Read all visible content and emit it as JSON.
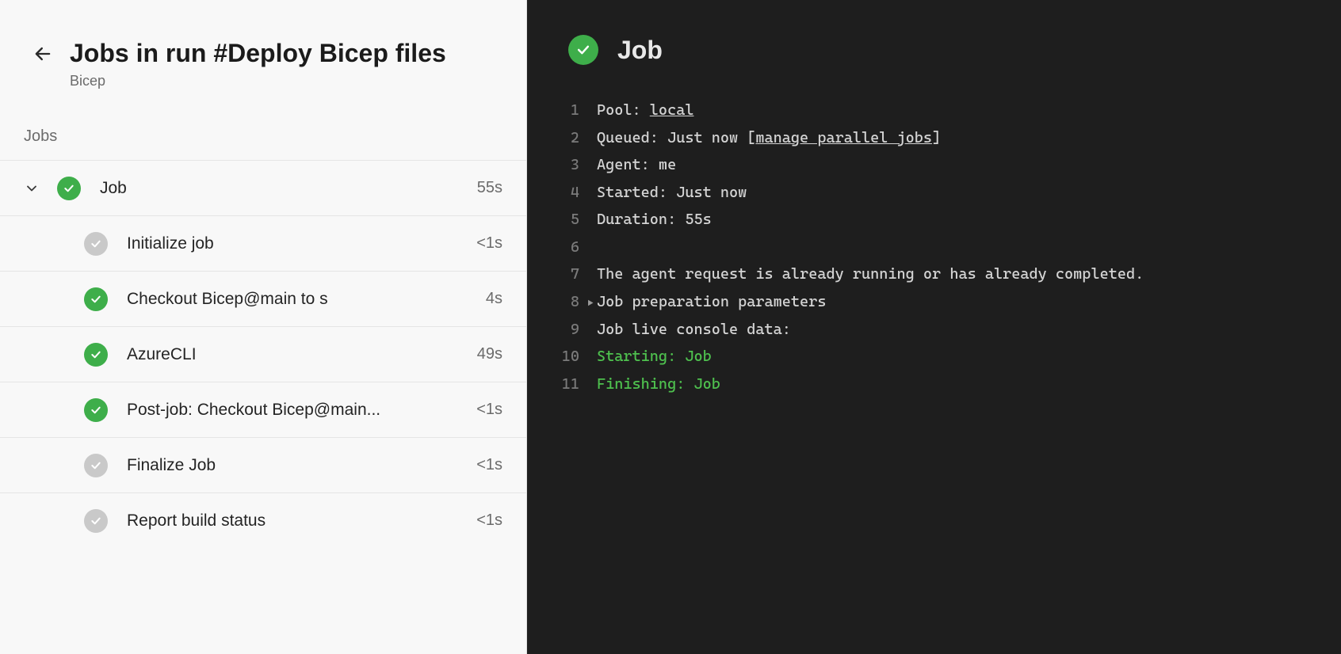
{
  "header": {
    "title": "Jobs in run #Deploy Bicep files",
    "subtitle": "Bicep"
  },
  "jobs_section_label": "Jobs",
  "job": {
    "name": "Job",
    "duration": "55s",
    "status": "success"
  },
  "steps": [
    {
      "label": "Initialize job",
      "duration": "<1s",
      "status": "grey"
    },
    {
      "label": "Checkout Bicep@main to s",
      "duration": "4s",
      "status": "green"
    },
    {
      "label": "AzureCLI",
      "duration": "49s",
      "status": "green"
    },
    {
      "label": "Post-job: Checkout Bicep@main...",
      "duration": "<1s",
      "status": "green"
    },
    {
      "label": "Finalize Job",
      "duration": "<1s",
      "status": "grey"
    },
    {
      "label": "Report build status",
      "duration": "<1s",
      "status": "grey"
    }
  ],
  "right": {
    "title": "Job",
    "pool_label": "Pool: ",
    "pool_value": "local",
    "queued_label": "Queued: Just now [",
    "queued_link": "manage parallel jobs",
    "queued_close": "]",
    "agent": "Agent: me",
    "started": "Started: Just now",
    "duration": "Duration: 55s",
    "msg_running": "The agent request is already running or has already completed.",
    "prep_params": "Job preparation parameters",
    "console_header": "Job live console data:",
    "starting": "Starting: Job",
    "finishing": "Finishing: Job"
  }
}
